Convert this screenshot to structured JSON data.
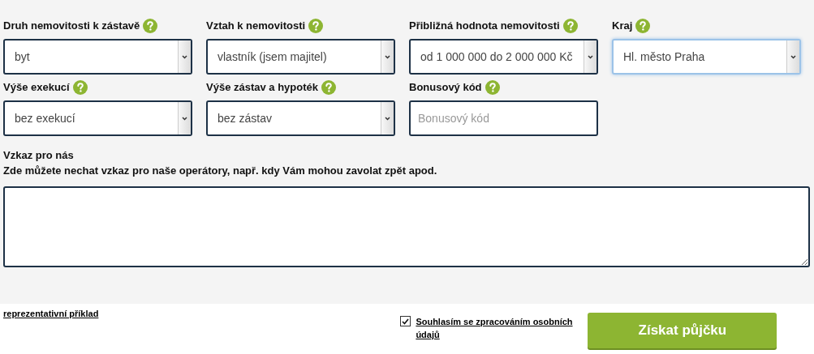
{
  "form_rows": [
    [
      {
        "label": "Druh nemovitosti k zástavě",
        "kind": "select",
        "value": "byt",
        "focused": false
      },
      {
        "label": "Vztah k nemovitosti",
        "kind": "select",
        "value": "vlastník (jsem majitel)",
        "focused": false
      },
      {
        "label": "Přibližná hodnota nemovitosti",
        "kind": "select",
        "value": "od 1 000 000 do 2 000 000 Kč",
        "focused": false
      },
      {
        "label": "Kraj",
        "kind": "select",
        "value": "Hl. město Praha",
        "focused": true
      }
    ],
    [
      {
        "label": "Výše exekucí",
        "kind": "select",
        "value": "bez exekucí",
        "focused": false
      },
      {
        "label": "Výše zástav a hypoték",
        "kind": "select",
        "value": "bez zástav",
        "focused": false
      },
      {
        "label": "Bonusový kód",
        "kind": "input",
        "placeholder": "Bonusový kód",
        "focused": false
      }
    ]
  ],
  "message": {
    "label": "Vzkaz pro nás",
    "hint": "Zde můžete nechat vzkaz pro naše operátory, např. kdy Vám mohou zavolat zpět apod."
  },
  "example_link": "reprezentativní příklad",
  "consent": {
    "label": "Souhlasím se zpracováním osobních údajů",
    "checked": true
  },
  "submit_button": "Získat půjčku"
}
